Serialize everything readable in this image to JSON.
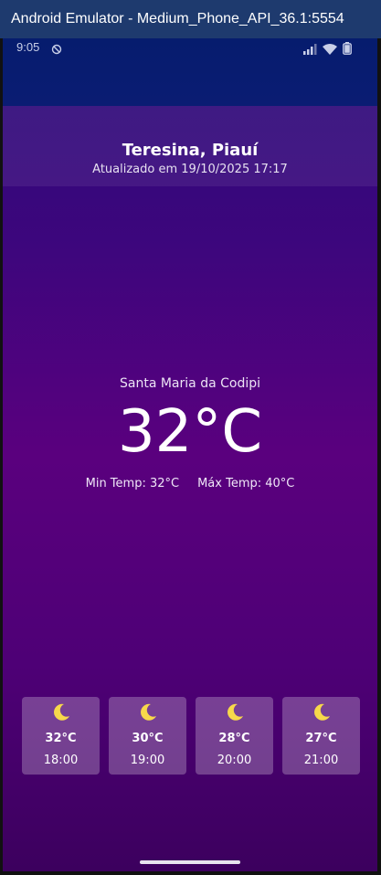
{
  "window": {
    "title": "Android Emulator - Medium_Phone_API_36.1:5554"
  },
  "status_bar": {
    "time": "9:05",
    "icons": [
      "do-not-disturb-icon",
      "signal-icon",
      "wifi-icon",
      "battery-icon"
    ]
  },
  "header": {
    "city": "Teresina, Piauí",
    "updated": "Atualizado em 19/10/2025 17:17"
  },
  "current": {
    "locality": "Santa Maria da Codipi",
    "temperature": "32°C",
    "min_temp": "Min Temp: 32°C",
    "max_temp": "Máx Temp: 40°C"
  },
  "forecast": [
    {
      "icon": "moon-icon",
      "temp": "32°C",
      "hour": "18:00"
    },
    {
      "icon": "moon-icon",
      "temp": "30°C",
      "hour": "19:00"
    },
    {
      "icon": "moon-icon",
      "temp": "28°C",
      "hour": "20:00"
    },
    {
      "icon": "moon-icon",
      "temp": "27°C",
      "hour": "21:00"
    }
  ],
  "colors": {
    "moon": "#f7d84b",
    "title_bar": "#1e3a6e"
  }
}
